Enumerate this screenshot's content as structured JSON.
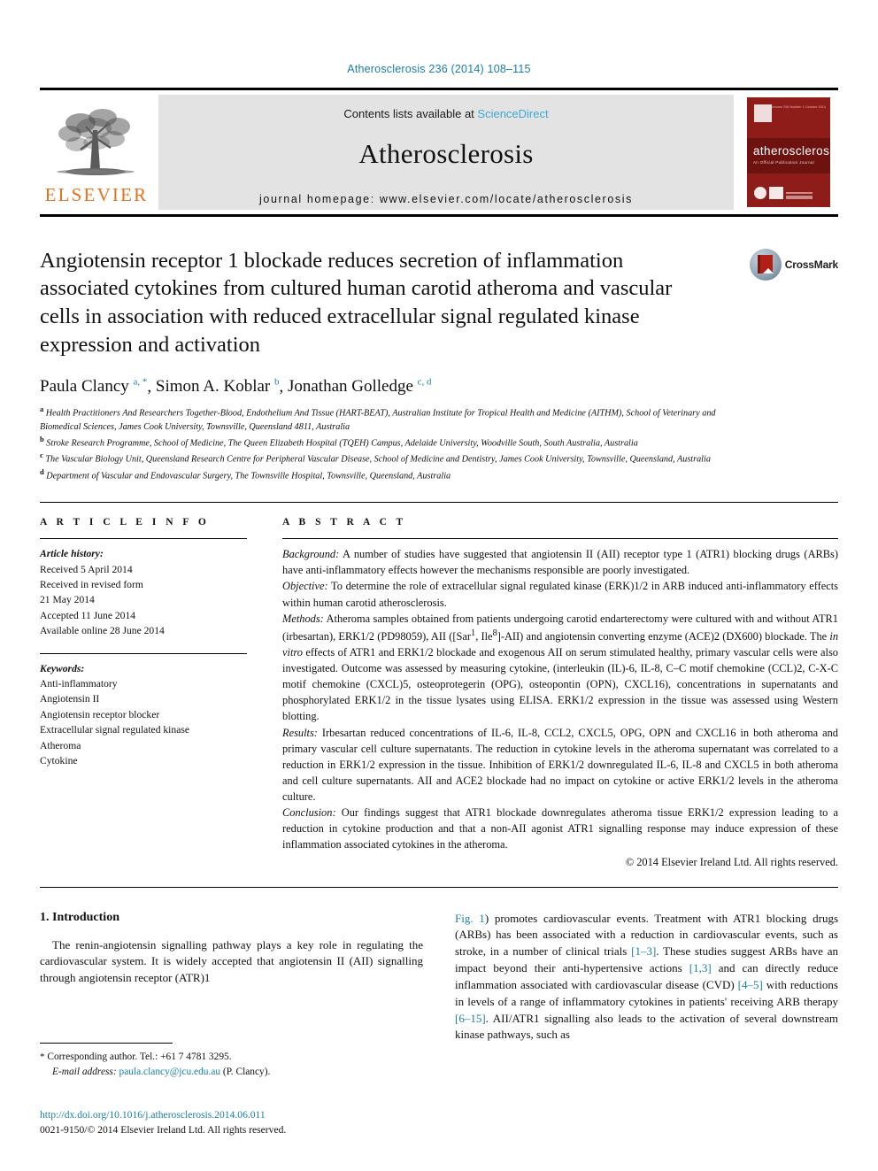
{
  "running_head": "Atherosclerosis 236 (2014) 108–115",
  "masthead": {
    "elsevier_wordmark": "ELSEVIER",
    "contents_prefix": "Contents lists available at ",
    "sciencedirect": "ScienceDirect",
    "journal_title": "Atherosclerosis",
    "homepage": "journal homepage: www.elsevier.com/locate/atherosclerosis",
    "cover": {
      "title": "atherosclerosis",
      "subtitle": "An Official Publication Journal",
      "top_text": "Volume 236 Number 1 October 2014"
    },
    "accent_blue": "#3ba8d6",
    "elsevier_orange": "#E9711C",
    "cover_red": "#8E1C18"
  },
  "article": {
    "title": "Angiotensin receptor 1 blockade reduces secretion of inflammation associated cytokines from cultured human carotid atheroma and vascular cells in association with reduced extracellular signal regulated kinase expression and activation",
    "crossmark_label": "CrossMark",
    "authors": [
      {
        "name": "Paula Clancy",
        "marks": "a, *"
      },
      {
        "name": "Simon A. Koblar",
        "marks": "b"
      },
      {
        "name": "Jonathan Golledge",
        "marks": "c, d"
      }
    ],
    "affiliations": [
      {
        "mark": "a",
        "text": "Health Practitioners And Researchers Together-Blood, Endothelium And Tissue (HART-BEAT), Australian Institute for Tropical Health and Medicine (AITHM), School of Veterinary and Biomedical Sciences, James Cook University, Townsville, Queensland 4811, Australia"
      },
      {
        "mark": "b",
        "text": "Stroke Research Programme, School of Medicine, The Queen Elizabeth Hospital (TQEH) Campus, Adelaide University, Woodville South, South Australia, Australia"
      },
      {
        "mark": "c",
        "text": "The Vascular Biology Unit, Queensland Research Centre for Peripheral Vascular Disease, School of Medicine and Dentistry, James Cook University, Townsville, Queensland, Australia"
      },
      {
        "mark": "d",
        "text": "Department of Vascular and Endovascular Surgery, The Townsville Hospital, Townsville, Queensland, Australia"
      }
    ]
  },
  "article_info": {
    "heading": "A R T I C L E   I N F O",
    "history_label": "Article history:",
    "history": [
      "Received 5 April 2014",
      "Received in revised form",
      "21 May 2014",
      "Accepted 11 June 2014",
      "Available online 28 June 2014"
    ],
    "keywords_label": "Keywords:",
    "keywords": [
      "Anti-inflammatory",
      "Angiotensin II",
      "Angiotensin receptor blocker",
      "Extracellular signal regulated kinase",
      "Atheroma",
      "Cytokine"
    ]
  },
  "abstract": {
    "heading": "A B S T R A C T",
    "background_label": "Background:",
    "background": " A number of studies have suggested that angiotensin II (AII) receptor type 1 (ATR1) blocking drugs (ARBs) have anti-inflammatory effects however the mechanisms responsible are poorly investigated.",
    "objective_label": "Objective:",
    "objective": " To determine the role of extracellular signal regulated kinase (ERK)1/2 in ARB induced anti-inflammatory effects within human carotid atherosclerosis.",
    "methods_label": "Methods:",
    "methods_part1": " Atheroma samples obtained from patients undergoing carotid endarterectomy were cultured with and without ATR1 (irbesartan), ERK1/2 (PD98059), AII ([Sar",
    "methods_sup1": "1",
    "methods_part2": ", Ile",
    "methods_sup2": "8",
    "methods_part3": "]-AII) and angiotensin converting enzyme (ACE)2 (DX600) blockade. The ",
    "methods_italic": "in vitro",
    "methods_part4": " effects of ATR1 and ERK1/2 blockade and exogenous AII on serum stimulated healthy, primary vascular cells were also investigated. Outcome was assessed by measuring cytokine, (interleukin (IL)-6, IL-8, C–C motif chemokine (CCL)2, C-X-C motif chemokine (CXCL)5, osteoprotegerin (OPG), osteopontin (OPN), CXCL16), concentrations in supernatants and phosphorylated ERK1/2 in the tissue lysates using ELISA. ERK1/2 expression in the tissue was assessed using Western blotting.",
    "results_label": "Results:",
    "results": " Irbesartan reduced concentrations of IL-6, IL-8, CCL2, CXCL5, OPG, OPN and CXCL16 in both atheroma and primary vascular cell culture supernatants. The reduction in cytokine levels in the atheroma supernatant was correlated to a reduction in ERK1/2 expression in the tissue. Inhibition of ERK1/2 downregulated IL-6, IL-8 and CXCL5 in both atheroma and cell culture supernatants. AII and ACE2 blockade had no impact on cytokine or active ERK1/2 levels in the atheroma culture.",
    "conclusion_label": "Conclusion:",
    "conclusion": " Our findings suggest that ATR1 blockade downregulates atheroma tissue ERK1/2 expression leading to a reduction in cytokine production and that a non-AII agonist ATR1 signalling response may induce expression of these inflammation associated cytokines in the atheroma.",
    "copyright": "© 2014 Elsevier Ireland Ltd. All rights reserved."
  },
  "introduction": {
    "heading": "1. Introduction",
    "col_left": "The renin-angiotensin signalling pathway plays a key role in regulating the cardiovascular system. It is widely accepted that angiotensin II (AII) signalling through angiotensin receptor (ATR)1",
    "col_right_parts": {
      "fig_ref": "Fig. 1",
      "t1": ") promotes cardiovascular events. Treatment with ATR1 blocking drugs (ARBs) has been associated with a reduction in cardiovascular events, such as stroke, in a number of clinical trials ",
      "r1": "[1–3]",
      "t2": ". These studies suggest ARBs have an impact beyond their anti-hypertensive actions ",
      "r2": "[1,3]",
      "t3": " and can directly reduce inflammation associated with cardiovascular disease (CVD) ",
      "r3": "[4–5]",
      "t4": " with reductions in levels of a range of inflammatory cytokines in patients' receiving ARB therapy ",
      "r4": "[6–15]",
      "t5": ". AII/ATR1 signalling also leads to the activation of several downstream kinase pathways, such as"
    }
  },
  "footnote": {
    "star": "*",
    "corresponding": " Corresponding author. Tel.: +61 7 4781 3295.",
    "email_label": "E-mail address:",
    "email": "paula.clancy@jcu.edu.au",
    "email_suffix": " (P. Clancy)."
  },
  "footer": {
    "doi": "http://dx.doi.org/10.1016/j.atherosclerosis.2014.06.011",
    "issn_line": "0021-9150/© 2014 Elsevier Ireland Ltd. All rights reserved."
  }
}
